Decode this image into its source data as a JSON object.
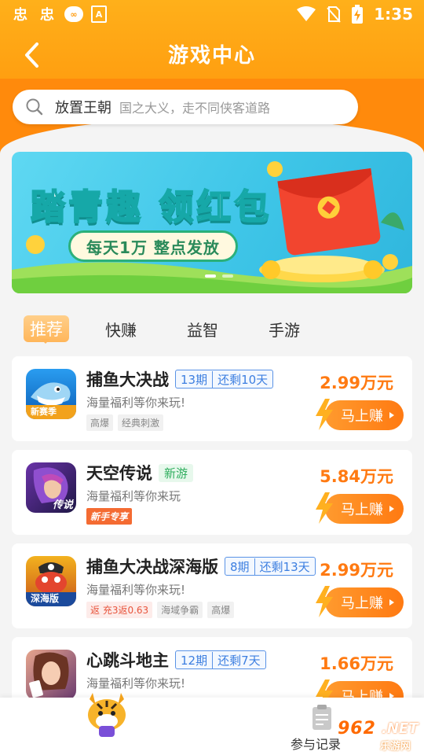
{
  "status_bar": {
    "left_icons": [
      "notification-app-icon",
      "notification-app-icon",
      "infinity-badge-icon",
      "text-badge-icon"
    ],
    "left_glyphs": [
      "忠",
      "忠",
      "∞",
      "A"
    ],
    "right_icons": [
      "wifi-icon",
      "no-sim-icon",
      "battery-charging-icon"
    ],
    "time": "1:35"
  },
  "header": {
    "title": "游戏中心",
    "back_icon": "chevron-left-icon"
  },
  "search": {
    "icon": "search-icon",
    "value": "放置王朝",
    "hint": "国之大义，走不同侠客道路"
  },
  "banner": {
    "title": "踏青趣 领红包",
    "subtitle": "每天1万 整点发放",
    "slide_count": 2,
    "active_slide": 0
  },
  "tabs": [
    {
      "label": "推荐",
      "active": true
    },
    {
      "label": "快赚",
      "active": false
    },
    {
      "label": "益智",
      "active": false
    },
    {
      "label": "手游",
      "active": false
    }
  ],
  "games": [
    {
      "name": "捕鱼大决战",
      "period": "13期",
      "remaining": "还剩10天",
      "badge_new": "",
      "desc": "海量福利等你来玩!",
      "tags": [
        {
          "text": "高爆",
          "style": "gray"
        },
        {
          "text": "经典刺激",
          "style": "gray"
        }
      ],
      "amount": "2.99万元",
      "button": "马上赚",
      "thumb_label": "新赛季",
      "thumb_colors": [
        "#f7a61b",
        "#d8341f"
      ]
    },
    {
      "name": "天空传说",
      "period": "",
      "remaining": "",
      "badge_new": "新游",
      "desc": "海量福利等你来玩",
      "tags": [
        {
          "text": "新手专享",
          "style": "orange"
        }
      ],
      "amount": "5.84万元",
      "button": "马上赚",
      "thumb_label": "传说",
      "thumb_colors": [
        "#5a2b8a",
        "#1f1746"
      ]
    },
    {
      "name": "捕鱼大决战深海版",
      "period": "8期",
      "remaining": "还剩13天",
      "badge_new": "",
      "desc": "海量福利等你来玩!",
      "tags": [
        {
          "text": "返 充3返0.63",
          "style": "red"
        },
        {
          "text": "海域争霸",
          "style": "gray"
        },
        {
          "text": "高爆",
          "style": "gray"
        }
      ],
      "amount": "2.99万元",
      "button": "马上赚",
      "thumb_label": "深海版",
      "thumb_colors": [
        "#f3b21e",
        "#1b4a9c"
      ]
    },
    {
      "name": "心跳斗地主",
      "period": "12期",
      "remaining": "还剩7天",
      "badge_new": "",
      "desc": "海量福利等你来玩!",
      "tags": [
        {
          "text": "",
          "style": "orange"
        },
        {
          "text": "",
          "style": "gray"
        },
        {
          "text": "",
          "style": "gray"
        }
      ],
      "amount": "1.66万元",
      "button": "马上赚",
      "thumb_label": "",
      "thumb_colors": [
        "#e7a58d",
        "#6b3b6f"
      ]
    }
  ],
  "bottom_bar": {
    "record_label": "参与记录",
    "record_icon": "clipboard-icon",
    "mascot_icon": "tiger-mascot-icon"
  },
  "watermark": {
    "num": "962",
    "net": ".NET",
    "cn": "乐游网"
  },
  "colors": {
    "primary": "#ff9c0f",
    "amount": "#ff7a12",
    "period": "#3d7fe0",
    "new": "#2fae5e"
  }
}
